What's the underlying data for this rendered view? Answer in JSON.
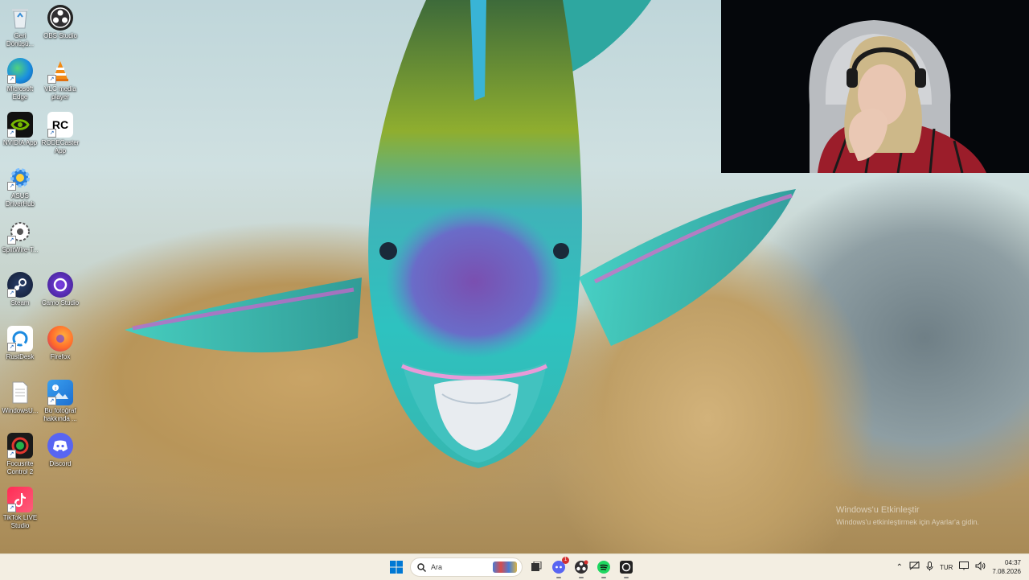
{
  "desktop": {
    "icons": [
      {
        "label": "Geri Dönüşü...",
        "icon": "recycle-bin-icon"
      },
      {
        "label": "OBS Studio",
        "icon": "obs-icon"
      },
      {
        "label": "Microsoft Edge",
        "icon": "edge-icon"
      },
      {
        "label": "VLC media player",
        "icon": "vlc-icon"
      },
      {
        "label": "NVIDIA App",
        "icon": "nvidia-icon"
      },
      {
        "label": "RODECaster App",
        "icon": "rodecaster-icon"
      },
      {
        "label": "ASUS DriverHub",
        "icon": "asus-driverhub-icon"
      },
      {
        "label": "SplitWire-T...",
        "icon": "splitwire-icon"
      },
      {
        "label": "Steam",
        "icon": "steam-icon"
      },
      {
        "label": "Camo Studio",
        "icon": "camo-icon"
      },
      {
        "label": "RustDesk",
        "icon": "rustdesk-icon"
      },
      {
        "label": "Firefox",
        "icon": "firefox-icon"
      },
      {
        "label": "WindowsU...",
        "icon": "text-file-icon"
      },
      {
        "label": "Bu fotoğraf hakkında ...",
        "icon": "photo-info-icon"
      },
      {
        "label": "Focusrite Control 2",
        "icon": "focusrite-icon"
      },
      {
        "label": "Discord",
        "icon": "discord-icon"
      },
      {
        "label": "TikTok LIVE Studio",
        "icon": "tiktok-icon"
      }
    ]
  },
  "watermark": {
    "line1": "Windows'u Etkinleştir",
    "line2": "Windows'u etkinleştirmek için Ayarlar'a gidin."
  },
  "taskbar": {
    "search_placeholder": "Ara",
    "discord_badge": "1",
    "tray_language": "TUR",
    "clock_time": "04:37",
    "clock_date": "7.08.2026"
  },
  "colors": {
    "taskbar_bg": "#f3eee2",
    "windows_blue": "#0078d4"
  }
}
